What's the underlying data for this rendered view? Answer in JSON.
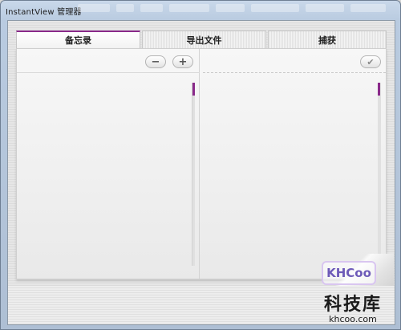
{
  "window": {
    "title": "InstantView 管理器"
  },
  "tabs": [
    {
      "label": "备忘录",
      "active": true
    },
    {
      "label": "导出文件",
      "active": false
    },
    {
      "label": "捕获",
      "active": false
    }
  ],
  "left_pane": {
    "minus_button": "−",
    "plus_button": "+"
  },
  "right_pane": {
    "check_button": "✔"
  },
  "watermark": {
    "logo_text": "KHCoo",
    "cn_text": "科技库",
    "url_text": "khcoo.com"
  },
  "colors": {
    "accent": "#8a2a8a",
    "frame": "#b9cbe0"
  }
}
